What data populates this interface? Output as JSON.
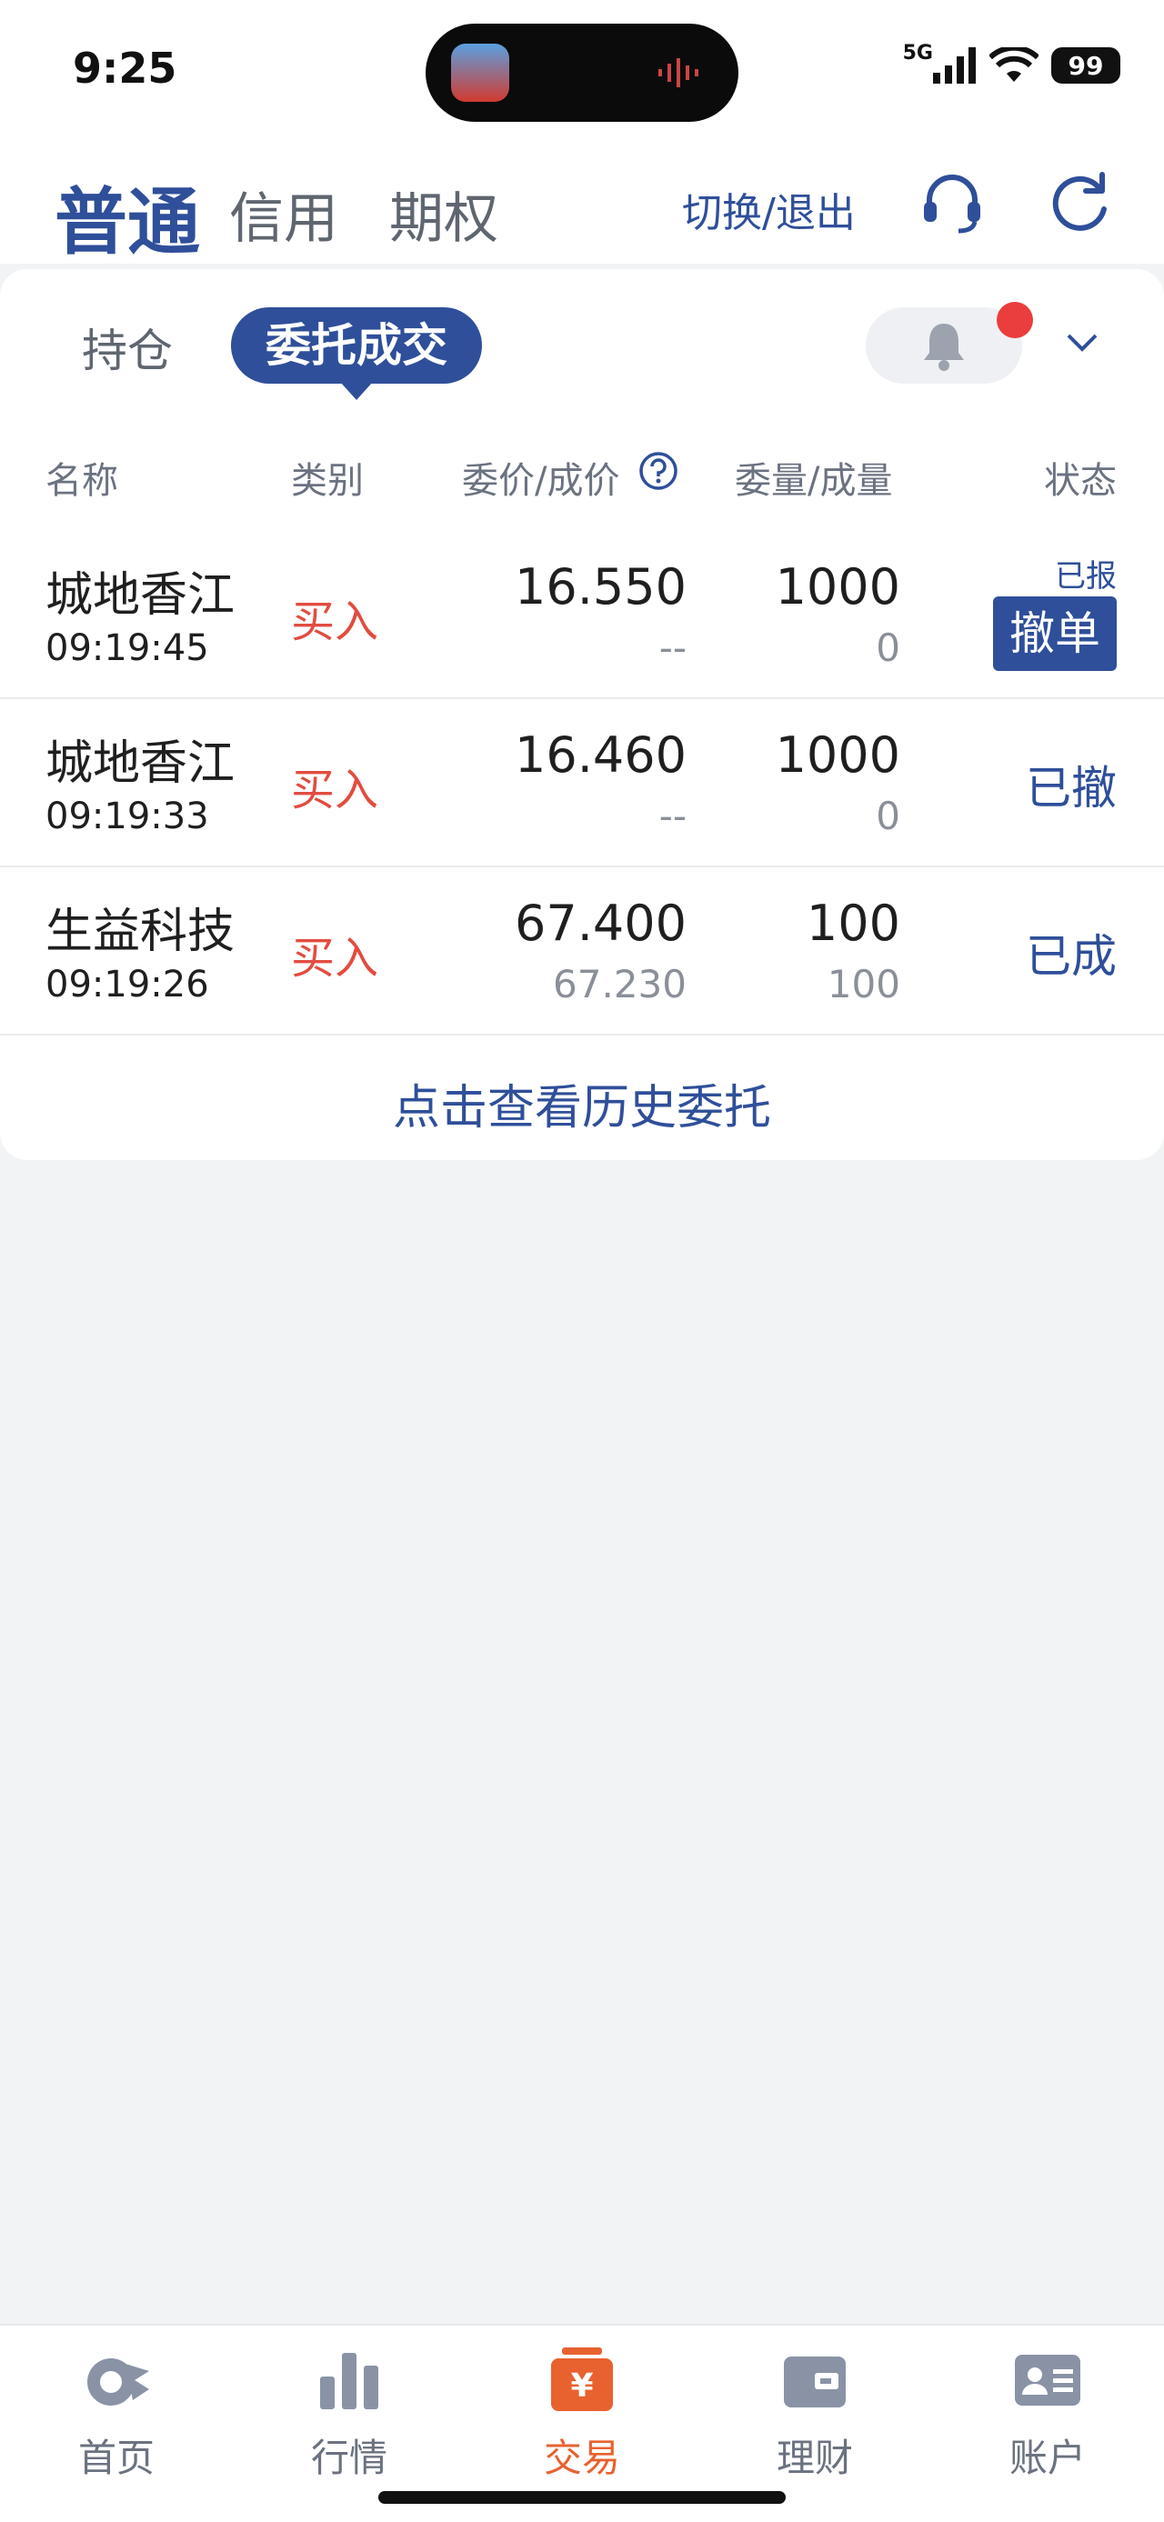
{
  "status_bar": {
    "time": "9:25",
    "network": "5G",
    "battery": "99"
  },
  "top_tabs": {
    "normal": "普通",
    "credit": "信用",
    "options": "期权"
  },
  "switch_exit": "切换/退出",
  "icons": {
    "support": "headset-icon",
    "refresh": "refresh-icon",
    "bell": "bell-icon"
  },
  "sub_tabs": {
    "holdings": "持仓",
    "orders": "委托成交"
  },
  "table": {
    "headers": {
      "name": "名称",
      "type": "类别",
      "price": "委价/成价",
      "qty": "委量/成量",
      "status": "状态"
    },
    "rows": [
      {
        "name": "城地香江",
        "time": "09:19:45",
        "side": "买入",
        "order_price": "16.550",
        "deal_price": "--",
        "order_qty": "1000",
        "deal_qty": "0",
        "status_small": "已报",
        "action": "撤单"
      },
      {
        "name": "城地香江",
        "time": "09:19:33",
        "side": "买入",
        "order_price": "16.460",
        "deal_price": "--",
        "order_qty": "1000",
        "deal_qty": "0",
        "status": "已撤"
      },
      {
        "name": "生益科技",
        "time": "09:19:26",
        "side": "买入",
        "order_price": "67.400",
        "deal_price": "67.230",
        "order_qty": "100",
        "deal_qty": "100",
        "status": "已成"
      }
    ]
  },
  "history_link": "点击查看历史委托",
  "bottom_nav": [
    {
      "label": "首页",
      "icon": "home-icon"
    },
    {
      "label": "行情",
      "icon": "market-chart-icon"
    },
    {
      "label": "交易",
      "icon": "trade-yen-icon",
      "active": true
    },
    {
      "label": "理财",
      "icon": "wallet-icon"
    },
    {
      "label": "账户",
      "icon": "account-card-icon"
    }
  ],
  "colors": {
    "brand": "#2f4f9a",
    "buy": "#e24c40",
    "active_tab": "#e8622f"
  }
}
